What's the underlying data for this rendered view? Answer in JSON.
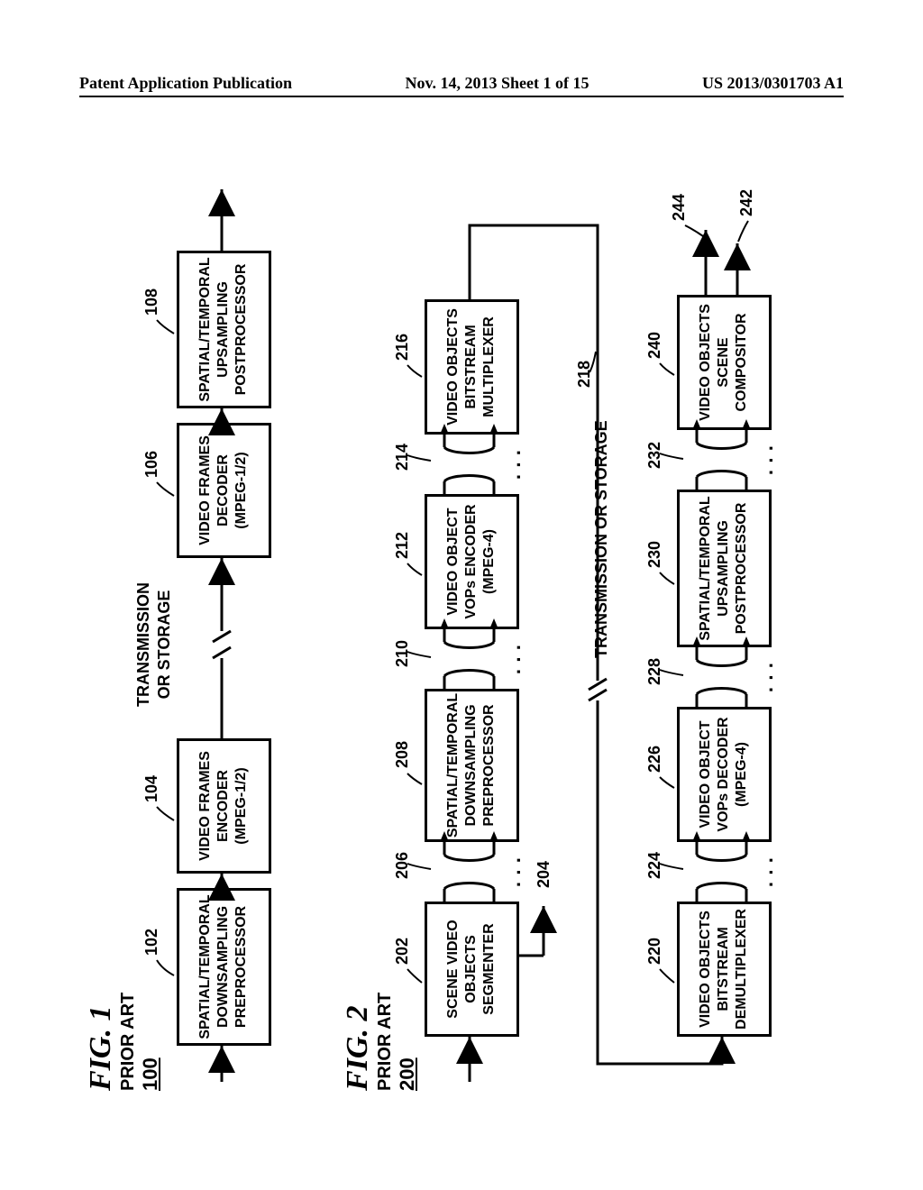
{
  "header": {
    "left": "Patent Application Publication",
    "middle": "Nov. 14, 2013  Sheet 1 of 15",
    "right": "US 2013/0301703 A1"
  },
  "fig1": {
    "label": "FIG. 1",
    "prior_art": "PRIOR ART",
    "ref": "100",
    "mid": "TRANSMISSION\nOR STORAGE",
    "boxes": {
      "b1": {
        "ref": "102",
        "text": "SPATIAL/TEMPORAL\nDOWNSAMPLING\nPREPROCESSOR"
      },
      "b2": {
        "ref": "104",
        "text": "VIDEO FRAMES\nENCODER\n(MPEG-1/2)"
      },
      "b3": {
        "ref": "106",
        "text": "VIDEO FRAMES\nDECODER\n(MPEG-1/2)"
      },
      "b4": {
        "ref": "108",
        "text": "SPATIAL/TEMPORAL\nUPSAMPLING\nPOSTPROCESSOR"
      }
    }
  },
  "fig2": {
    "label": "FIG. 2",
    "prior_art": "PRIOR ART",
    "ref": "200",
    "in_ref": "200",
    "seg_out_ref": "204",
    "mid": "TRANSMISSION OR STORAGE",
    "mid_ref": "218",
    "out_refs": {
      "out1": "242",
      "out2": "244"
    },
    "rowA": {
      "seg": {
        "ref": "202",
        "text": "SCENE VIDEO\nOBJECTS\nSEGMENTER"
      },
      "dotsA": {
        "ref": "206"
      },
      "pre": {
        "ref": "208",
        "text": "SPATIAL/TEMPORAL\nDOWNSAMPLING\nPREPROCESSOR"
      },
      "dotsB": {
        "ref": "210"
      },
      "enc": {
        "ref": "212",
        "text": "VIDEO OBJECT\nVOPs ENCODER\n(MPEG-4)"
      },
      "dotsC": {
        "ref": "214"
      },
      "mux": {
        "ref": "216",
        "text": "VIDEO OBJECTS\nBITSTREAM\nMULTIPLEXER"
      }
    },
    "rowB": {
      "dmx": {
        "ref": "220",
        "text": "VIDEO OBJECTS\nBITSTREAM\nDEMULTIPLEXER"
      },
      "dotsA": {
        "ref": "224"
      },
      "dec": {
        "ref": "226",
        "text": "VIDEO OBJECT\nVOPs DECODER\n(MPEG-4)"
      },
      "dotsB": {
        "ref": "228"
      },
      "post": {
        "ref": "230",
        "text": "SPATIAL/TEMPORAL\nUPSAMPLING\nPOSTPROCESSOR"
      },
      "dotsC": {
        "ref": "232"
      },
      "comp": {
        "ref": "240",
        "text": "VIDEO OBJECTS\nSCENE\nCOMPOSITOR"
      }
    }
  },
  "chart_data": {
    "type": "diagram",
    "figures": [
      {
        "id": "FIG. 1",
        "title": "PRIOR ART",
        "ref": "100",
        "nodes": [
          {
            "id": "102",
            "label": "SPATIAL/TEMPORAL DOWNSAMPLING PREPROCESSOR"
          },
          {
            "id": "104",
            "label": "VIDEO FRAMES ENCODER (MPEG-1/2)"
          },
          {
            "id": "transmission",
            "label": "TRANSMISSION OR STORAGE"
          },
          {
            "id": "106",
            "label": "VIDEO FRAMES DECODER (MPEG-1/2)"
          },
          {
            "id": "108",
            "label": "SPATIAL/TEMPORAL UPSAMPLING POSTPROCESSOR"
          }
        ],
        "edges": [
          [
            "input",
            "102"
          ],
          [
            "102",
            "104"
          ],
          [
            "104",
            "transmission"
          ],
          [
            "transmission",
            "106"
          ],
          [
            "106",
            "108"
          ],
          [
            "108",
            "output"
          ]
        ]
      },
      {
        "id": "FIG. 2",
        "title": "PRIOR ART",
        "ref": "200",
        "nodes": [
          {
            "id": "202",
            "label": "SCENE VIDEO OBJECTS SEGMENTER"
          },
          {
            "id": "208",
            "label": "SPATIAL/TEMPORAL DOWNSAMPLING PREPROCESSOR"
          },
          {
            "id": "212",
            "label": "VIDEO OBJECT VOPs ENCODER (MPEG-4)"
          },
          {
            "id": "216",
            "label": "VIDEO OBJECTS BITSTREAM MULTIPLEXER"
          },
          {
            "id": "218",
            "label": "TRANSMISSION OR STORAGE"
          },
          {
            "id": "220",
            "label": "VIDEO OBJECTS BITSTREAM DEMULTIPLEXER"
          },
          {
            "id": "226",
            "label": "VIDEO OBJECT VOPs DECODER (MPEG-4)"
          },
          {
            "id": "230",
            "label": "SPATIAL/TEMPORAL UPSAMPLING POSTPROCESSOR"
          },
          {
            "id": "240",
            "label": "VIDEO OBJECTS SCENE COMPOSITOR"
          }
        ],
        "bus_refs": [
          "204",
          "206",
          "210",
          "214",
          "224",
          "228",
          "232",
          "242",
          "244"
        ],
        "edges": [
          [
            "input200",
            "202"
          ],
          [
            "202",
            "208",
            "bus206"
          ],
          [
            "208",
            "212",
            "bus210"
          ],
          [
            "212",
            "216",
            "bus214"
          ],
          [
            "202",
            "204_out"
          ],
          [
            "216",
            "218"
          ],
          [
            "218",
            "220"
          ],
          [
            "220",
            "226",
            "bus224"
          ],
          [
            "226",
            "230",
            "bus228"
          ],
          [
            "230",
            "240",
            "bus232"
          ],
          [
            "240",
            "242_out"
          ],
          [
            "240",
            "244_out"
          ]
        ]
      }
    ]
  }
}
